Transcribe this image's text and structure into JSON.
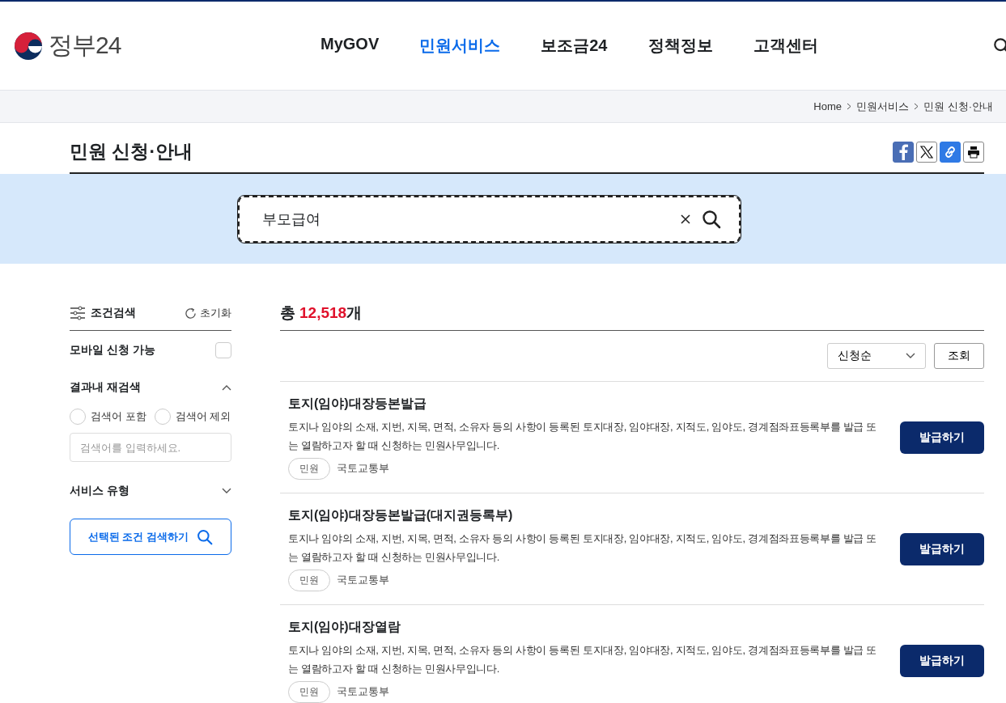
{
  "header": {
    "logo_text": "정부24",
    "nav": [
      {
        "label": "MyGOV",
        "selected": false
      },
      {
        "label": "민원서비스",
        "selected": true
      },
      {
        "label": "보조금24",
        "selected": false
      },
      {
        "label": "정책정보",
        "selected": false
      },
      {
        "label": "고객센터",
        "selected": false
      }
    ]
  },
  "breadcrumb": [
    "Home",
    "민원서비스",
    "민원 신청·안내"
  ],
  "page_title": "민원 신청·안내",
  "search": {
    "value": "부모급여"
  },
  "filters": {
    "title": "조건검색",
    "reset": "초기화",
    "mobile": {
      "label": "모바일 신청 가능",
      "checked": false
    },
    "refine": {
      "title": "결과내 재검색",
      "expanded": true,
      "options": [
        {
          "label": "검색어 포함",
          "selected": false
        },
        {
          "label": "검색어 제외",
          "selected": false
        }
      ],
      "placeholder": "검색어를 입력하세요."
    },
    "service_type": {
      "title": "서비스 유형",
      "expanded": false
    },
    "submit": "선택된 조건 검색하기"
  },
  "results": {
    "total_prefix": "총",
    "total_count": "12,518",
    "total_suffix": "개",
    "sort": "신청순",
    "query_button": "조회",
    "items": [
      {
        "title": "토지(임야)대장등본발급",
        "description": "토지나 임야의 소재, 지번, 지목, 면적, 소유자 등의 사항이 등록된 토지대장, 임야대장, 지적도, 임야도, 경계점좌표등록부를 발급 또는 열람하고자 할 때 신청하는 민원사무입니다.",
        "tag": "민원",
        "agency": "국토교통부",
        "action": "발급하기"
      },
      {
        "title": "토지(임야)대장등본발급(대지권등록부)",
        "description": "토지나 임야의 소재, 지번, 지목, 면적, 소유자 등의 사항이 등록된 토지대장, 임야대장, 지적도, 임야도, 경계점좌표등록부를 발급 또는 열람하고자 할 때 신청하는 민원사무입니다.",
        "tag": "민원",
        "agency": "국토교통부",
        "action": "발급하기"
      },
      {
        "title": "토지(임야)대장열람",
        "description": "토지나 임야의 소재, 지번, 지목, 면적, 소유자 등의 사항이 등록된 토지대장, 임야대장, 지적도, 임야도, 경계점좌표등록부를 발급 또는 열람하고자 할 때 신청하는 민원사무입니다.",
        "tag": "민원",
        "agency": "국토교통부",
        "action": "발급하기"
      }
    ]
  }
}
